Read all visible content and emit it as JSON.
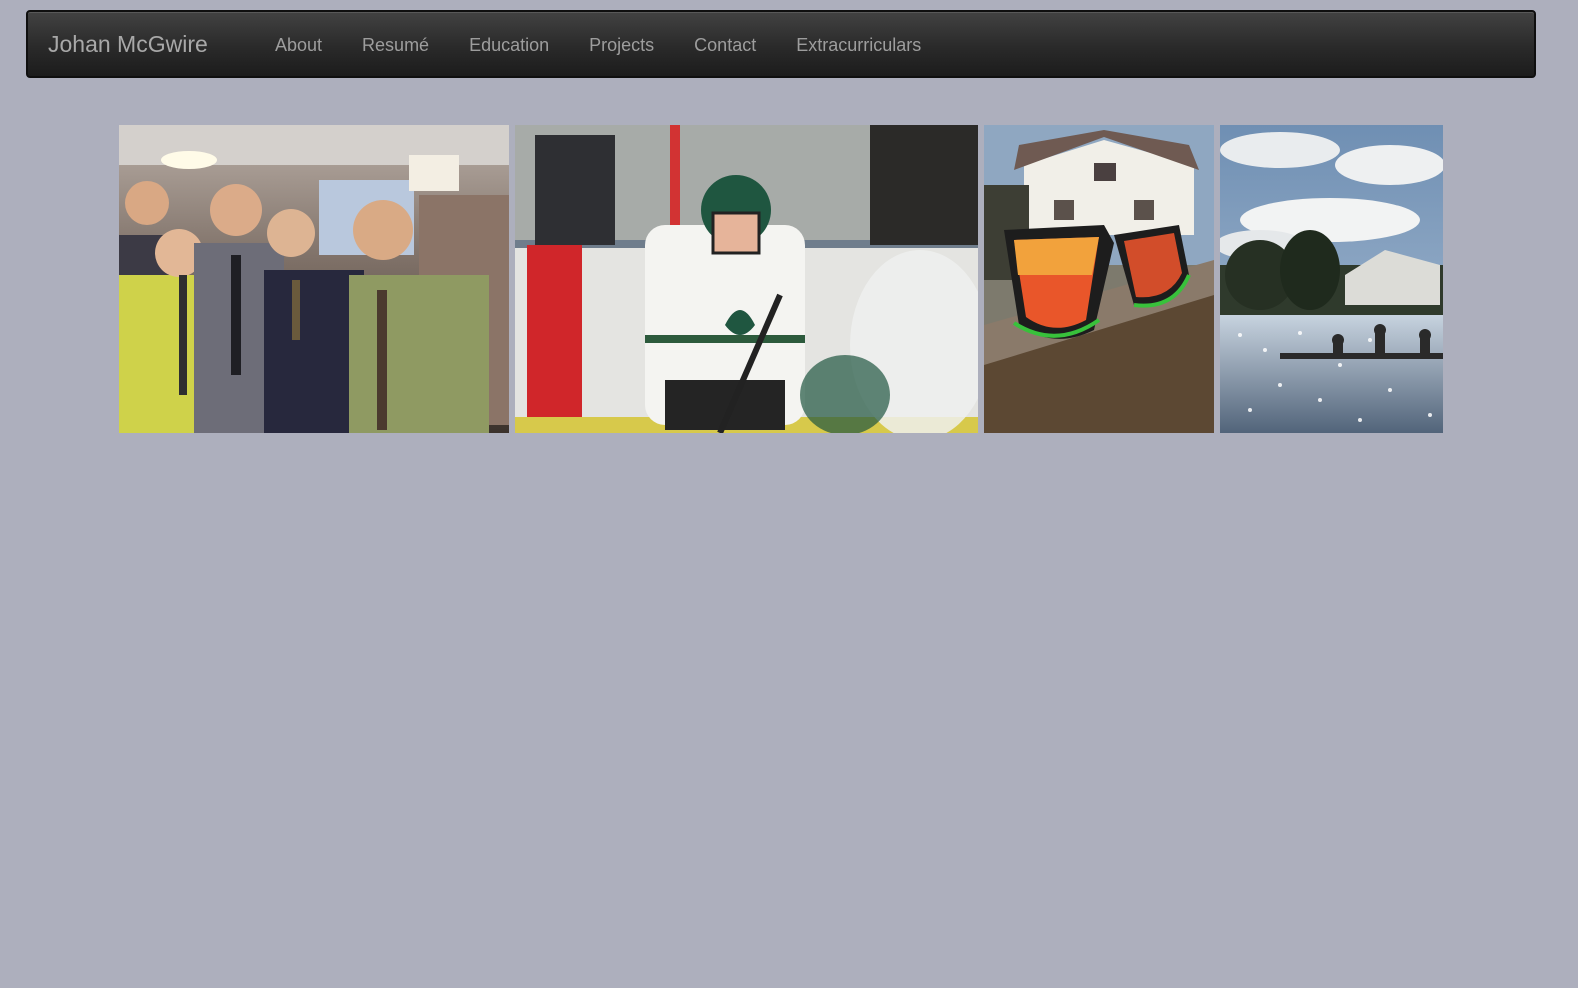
{
  "navbar": {
    "brand": "Johan McGwire",
    "items": [
      {
        "label": "About"
      },
      {
        "label": "Resumé"
      },
      {
        "label": "Education"
      },
      {
        "label": "Projects"
      },
      {
        "label": "Contact"
      },
      {
        "label": "Extracurriculars"
      }
    ]
  },
  "gallery": {
    "photos": [
      {
        "subject": "group-photo"
      },
      {
        "subject": "hockey-player"
      },
      {
        "subject": "sunglasses"
      },
      {
        "subject": "rowing-boat"
      }
    ]
  },
  "colors": {
    "page_background": "#adafbd",
    "navbar_background": "#2a2a2a",
    "nav_text": "#9d9d9d",
    "brand_text": "#a8a8a8"
  }
}
